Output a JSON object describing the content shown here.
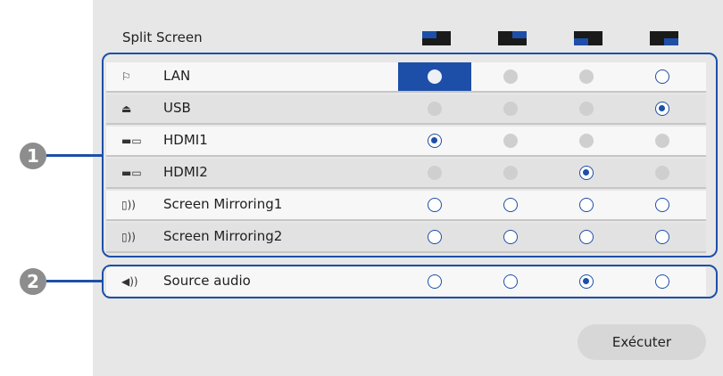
{
  "title": "Split Screen",
  "layouts": [
    "layout-top-left",
    "layout-top-right",
    "layout-bottom-left",
    "layout-bottom-right"
  ],
  "sources": [
    {
      "icon": "lan-icon",
      "glyph": "⚐",
      "label": "LAN",
      "states": [
        "selected",
        "disabled",
        "disabled",
        "empty"
      ]
    },
    {
      "icon": "usb-icon",
      "glyph": "⏏",
      "label": "USB",
      "states": [
        "disabled",
        "disabled",
        "disabled",
        "checked"
      ]
    },
    {
      "icon": "hdmi-icon",
      "glyph": "▬▭",
      "label": "HDMI1",
      "states": [
        "checked",
        "disabled",
        "disabled",
        "disabled"
      ]
    },
    {
      "icon": "hdmi-icon",
      "glyph": "▬▭",
      "label": "HDMI2",
      "states": [
        "disabled",
        "disabled",
        "checked",
        "disabled"
      ]
    },
    {
      "icon": "screen-mirroring-icon",
      "glyph": "▯))",
      "label": "Screen Mirroring1",
      "states": [
        "empty",
        "empty",
        "empty",
        "empty"
      ]
    },
    {
      "icon": "screen-mirroring-icon",
      "glyph": "▯))",
      "label": "Screen Mirroring2",
      "states": [
        "empty",
        "empty",
        "empty",
        "empty"
      ]
    }
  ],
  "audio": {
    "icon": "speaker-icon",
    "glyph": "◀))",
    "label": "Source audio",
    "states": [
      "empty",
      "empty",
      "checked",
      "empty"
    ]
  },
  "callouts": [
    "1",
    "2"
  ],
  "execute_label": "Exécuter",
  "colors": {
    "accent": "#1d4fa8",
    "panel": "#e7e7e7"
  }
}
